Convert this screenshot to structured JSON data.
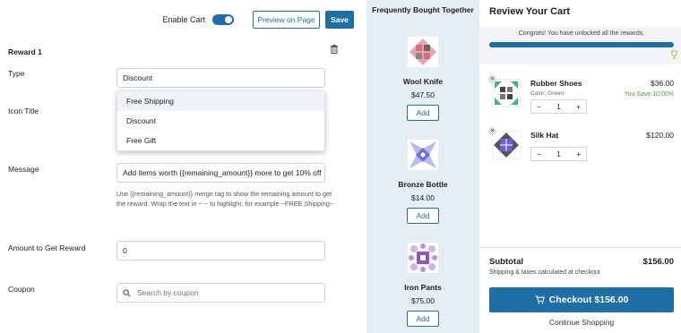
{
  "header": {
    "enable_cart_label": "Enable Cart",
    "enable_cart_on": true,
    "preview_label": "Preview on Page",
    "save_label": "Save"
  },
  "reward": {
    "title": "Reward 1",
    "type_label": "Type",
    "type_value": "Discount",
    "type_options": [
      "Free Shipping",
      "Discount",
      "Free Gift"
    ],
    "icon_title_label": "Icon Title",
    "message_label": "Message",
    "message_value": "Add items worth {{remaining_amount}} more to get 10% off",
    "message_help": "Use {{remaining_amount}} merge tag to show the remaining amount to get the reward. Wrap the text in ~ ~ to highlight. for example ~FREE Shipping~",
    "amount_label": "Amount to Get Reward",
    "amount_value": "0",
    "coupon_label": "Coupon",
    "coupon_placeholder": "Search by coupon"
  },
  "fbt": {
    "title": "Frequently Bought Together",
    "add_label": "Add",
    "products": [
      {
        "name": "Wool Knife",
        "price": "$47.50",
        "color": "#d9697e"
      },
      {
        "name": "Bronze Bottle",
        "price": "$14.00",
        "color": "#6b70d6"
      },
      {
        "name": "Iron Pants",
        "price": "$75.00",
        "color": "#9a4fc0"
      }
    ]
  },
  "cart": {
    "title": "Review Your Cart",
    "close_icon": "close-icon",
    "reward_message": "Congrats! You have unlocked all the rewards.",
    "reward_progress": 1.0,
    "items": [
      {
        "name": "Rubber Shoes",
        "variant": "Color: Green",
        "price": "$36.00",
        "saving": "You Save 10.00%",
        "qty": "1",
        "color": "#3bb58f"
      },
      {
        "name": "Silk Hat",
        "variant": "",
        "price": "$120.00",
        "saving": "",
        "qty": "1",
        "color": "#6b5fd6"
      }
    ],
    "subtotal_label": "Subtotal",
    "subtotal_value": "$156.00",
    "shipping_note": "Shipping & taxes calculated at checkout",
    "checkout_label": "Checkout",
    "checkout_amount": "$156.00",
    "continue_label": "Continue Shopping"
  },
  "colors": {
    "primary": "#1d6fa5",
    "panel_bg": "#e6edf3",
    "savings_green": "#4f9c3c"
  }
}
